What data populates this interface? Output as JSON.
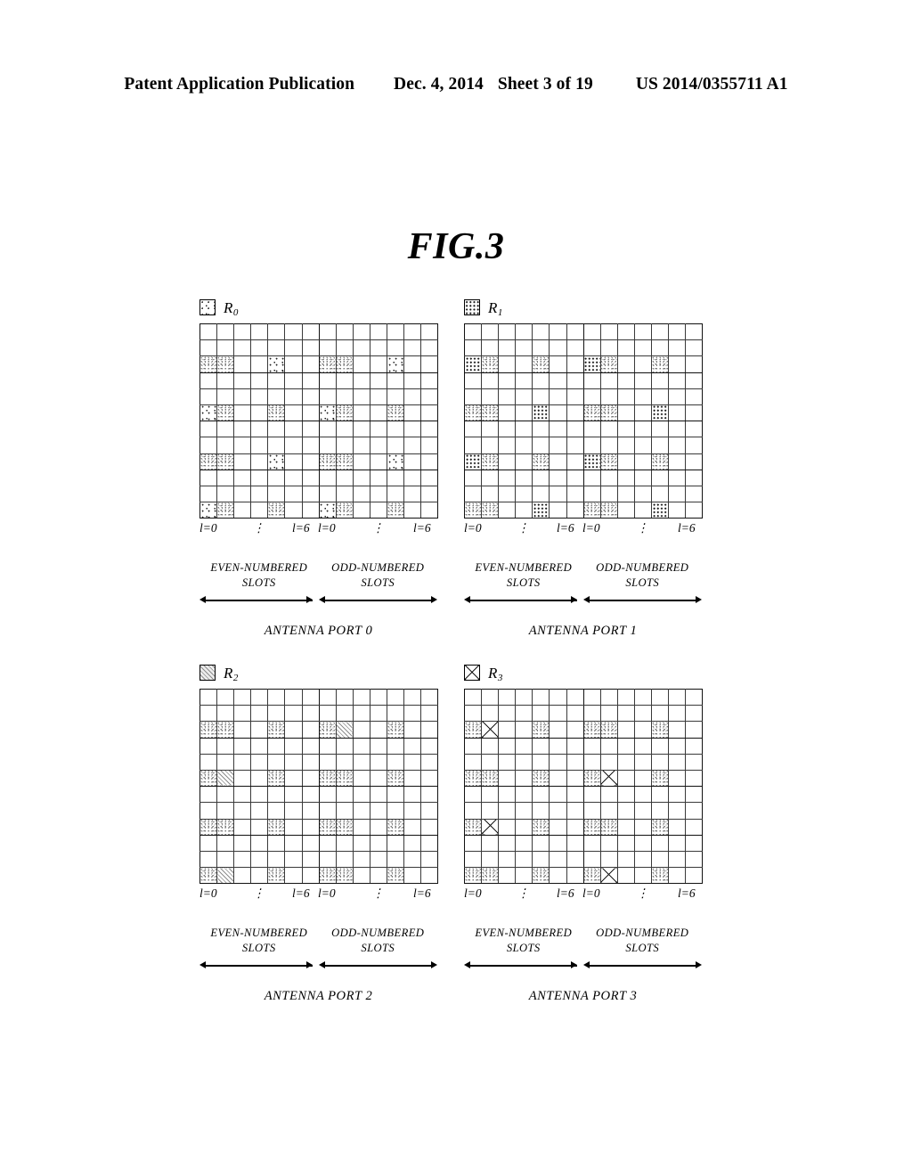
{
  "header": {
    "publication": "Patent Application Publication",
    "date": "Dec. 4, 2014",
    "sheet": "Sheet 3 of 19",
    "patent_number": "US 2014/0355711 A1"
  },
  "figure": {
    "title": "FIG.3"
  },
  "axis": {
    "left_start": "l=0",
    "left_end": "l=6",
    "right_start": "l=0",
    "right_end": "l=6",
    "dots": "⋮"
  },
  "slots": {
    "even_line1": "EVEN-NUMBERED",
    "even_line2": "SLOTS",
    "odd_line1": "ODD-NUMBERED",
    "odd_line2": "SLOTS"
  },
  "panels": [
    {
      "id": "r0",
      "legend_label": "R",
      "legend_sub": "0",
      "legend_fill": "fill-r0",
      "port_caption": "ANTENNA PORT 0",
      "rows": 12,
      "cols": 14,
      "cells": {
        "2": {
          "0": "fill-gray",
          "1": "fill-gray",
          "4": "fill-r0",
          "7": "fill-gray",
          "8": "fill-gray",
          "11": "fill-r0"
        },
        "5": {
          "0": "fill-r0",
          "1": "fill-gray",
          "4": "fill-gray",
          "7": "fill-r0",
          "8": "fill-gray",
          "11": "fill-gray"
        },
        "8": {
          "0": "fill-gray",
          "1": "fill-gray",
          "4": "fill-r0",
          "7": "fill-gray",
          "8": "fill-gray",
          "11": "fill-r0"
        },
        "11": {
          "0": "fill-r0",
          "1": "fill-gray",
          "4": "fill-gray",
          "7": "fill-r0",
          "8": "fill-gray",
          "11": "fill-gray"
        }
      }
    },
    {
      "id": "r1",
      "legend_label": "R",
      "legend_sub": "1",
      "legend_fill": "fill-r1",
      "port_caption": "ANTENNA PORT 1",
      "rows": 12,
      "cols": 14,
      "cells": {
        "2": {
          "0": "fill-r1",
          "1": "fill-gray",
          "4": "fill-gray",
          "7": "fill-r1",
          "8": "fill-gray",
          "11": "fill-gray"
        },
        "5": {
          "0": "fill-gray",
          "1": "fill-gray",
          "4": "fill-r1",
          "7": "fill-gray",
          "8": "fill-gray",
          "11": "fill-r1"
        },
        "8": {
          "0": "fill-r1",
          "1": "fill-gray",
          "4": "fill-gray",
          "7": "fill-r1",
          "8": "fill-gray",
          "11": "fill-gray"
        },
        "11": {
          "0": "fill-gray",
          "1": "fill-gray",
          "4": "fill-r1",
          "7": "fill-gray",
          "8": "fill-gray",
          "11": "fill-r1"
        }
      }
    },
    {
      "id": "r2",
      "legend_label": "R",
      "legend_sub": "2",
      "legend_fill": "fill-r2",
      "port_caption": "ANTENNA PORT 2",
      "rows": 12,
      "cols": 14,
      "cells": {
        "2": {
          "0": "fill-gray",
          "1": "fill-gray",
          "4": "fill-gray",
          "7": "fill-gray",
          "8": "fill-r2",
          "11": "fill-gray"
        },
        "5": {
          "0": "fill-gray",
          "1": "fill-r2",
          "4": "fill-gray",
          "7": "fill-gray",
          "8": "fill-gray",
          "11": "fill-gray"
        },
        "8": {
          "0": "fill-gray",
          "1": "fill-gray",
          "4": "fill-gray",
          "7": "fill-gray",
          "8": "fill-gray",
          "11": "fill-gray"
        },
        "11": {
          "0": "fill-gray",
          "1": "fill-r2",
          "4": "fill-gray",
          "7": "fill-gray",
          "8": "fill-gray",
          "11": "fill-gray"
        }
      }
    },
    {
      "id": "r3",
      "legend_label": "R",
      "legend_sub": "3",
      "legend_fill": "fill-r3",
      "port_caption": "ANTENNA PORT 3",
      "rows": 12,
      "cols": 14,
      "cells": {
        "2": {
          "0": "fill-gray",
          "1": "fill-r3",
          "4": "fill-gray",
          "7": "fill-gray",
          "8": "fill-gray",
          "11": "fill-gray"
        },
        "5": {
          "0": "fill-gray",
          "1": "fill-gray",
          "4": "fill-gray",
          "7": "fill-gray",
          "8": "fill-r3",
          "11": "fill-gray"
        },
        "8": {
          "0": "fill-gray",
          "1": "fill-r3",
          "4": "fill-gray",
          "7": "fill-gray",
          "8": "fill-gray",
          "11": "fill-gray"
        },
        "11": {
          "0": "fill-gray",
          "1": "fill-gray",
          "4": "fill-gray",
          "7": "fill-gray",
          "8": "fill-r3",
          "11": "fill-gray"
        }
      }
    }
  ]
}
